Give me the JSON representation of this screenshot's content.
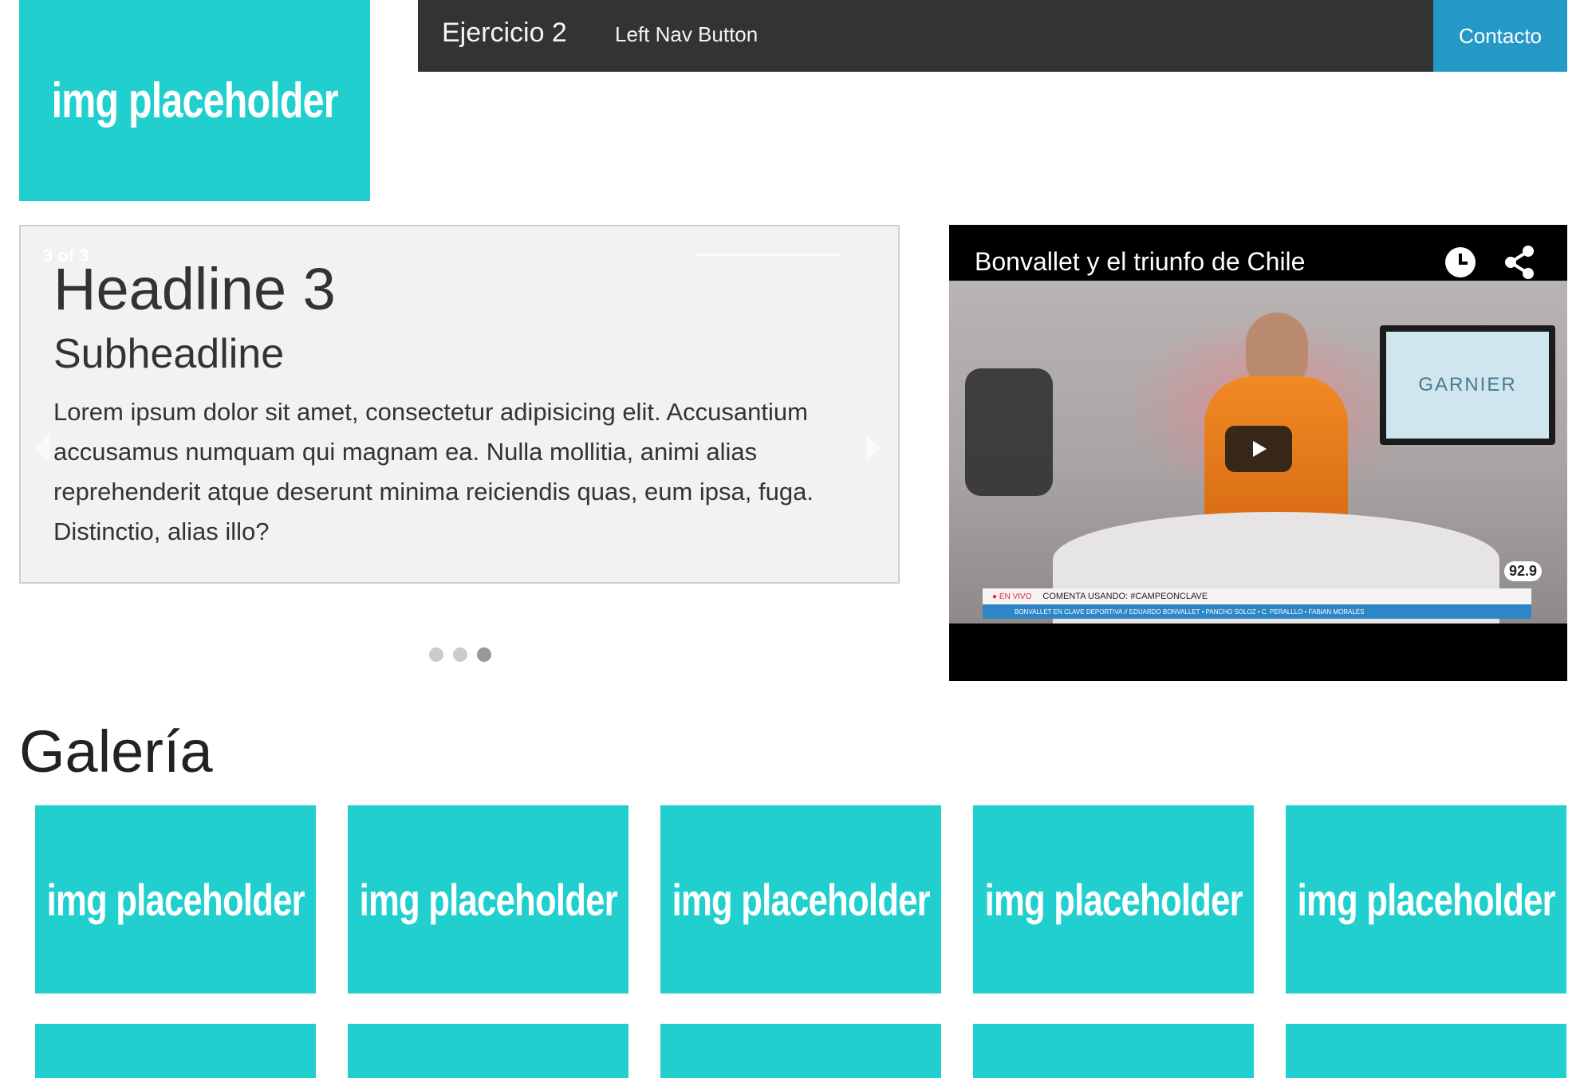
{
  "logo": {
    "label": "img placeholder"
  },
  "nav": {
    "brand": "Ejercicio 2",
    "left_button": "Left Nav Button",
    "contact": "Contacto"
  },
  "slider": {
    "counter": "3 of 3",
    "headline": "Headline 3",
    "subheadline": "Subheadline",
    "body": "Lorem ipsum dolor sit amet, consectetur adipisicing elit. Accusantium accusamus numquam qui magnam ea. Nulla mollitia, animi alias reprehenderit atque deserunt minima reiciendis quas, eum ipsa, fuga. Distinctio, alias illo?",
    "slides_total": 3,
    "active_slide": 3
  },
  "video": {
    "title": "Bonvallet y el triunfo de Chile",
    "tv_logo": "GARNIER",
    "ticker_live": "● EN VIVO",
    "ticker_text": "COMENTA USANDO: #CAMPEONCLAVE",
    "ticker_sub": "BONVALLET EN CLAVE DEPORTIVA // EDUARDO BONVALLET • PANCHO SOLOZ • C. PERALLLO • FABIAN MORALES",
    "badge": "92.9"
  },
  "gallery": {
    "title": "Galería",
    "items": [
      {
        "label": "img placeholder"
      },
      {
        "label": "img placeholder"
      },
      {
        "label": "img placeholder"
      },
      {
        "label": "img placeholder"
      },
      {
        "label": "img placeholder"
      },
      {
        "label": ""
      },
      {
        "label": ""
      },
      {
        "label": ""
      },
      {
        "label": ""
      },
      {
        "label": ""
      }
    ]
  },
  "colors": {
    "placeholder": "#22cfcf",
    "navbar": "#333333",
    "contact": "#2599c6"
  }
}
